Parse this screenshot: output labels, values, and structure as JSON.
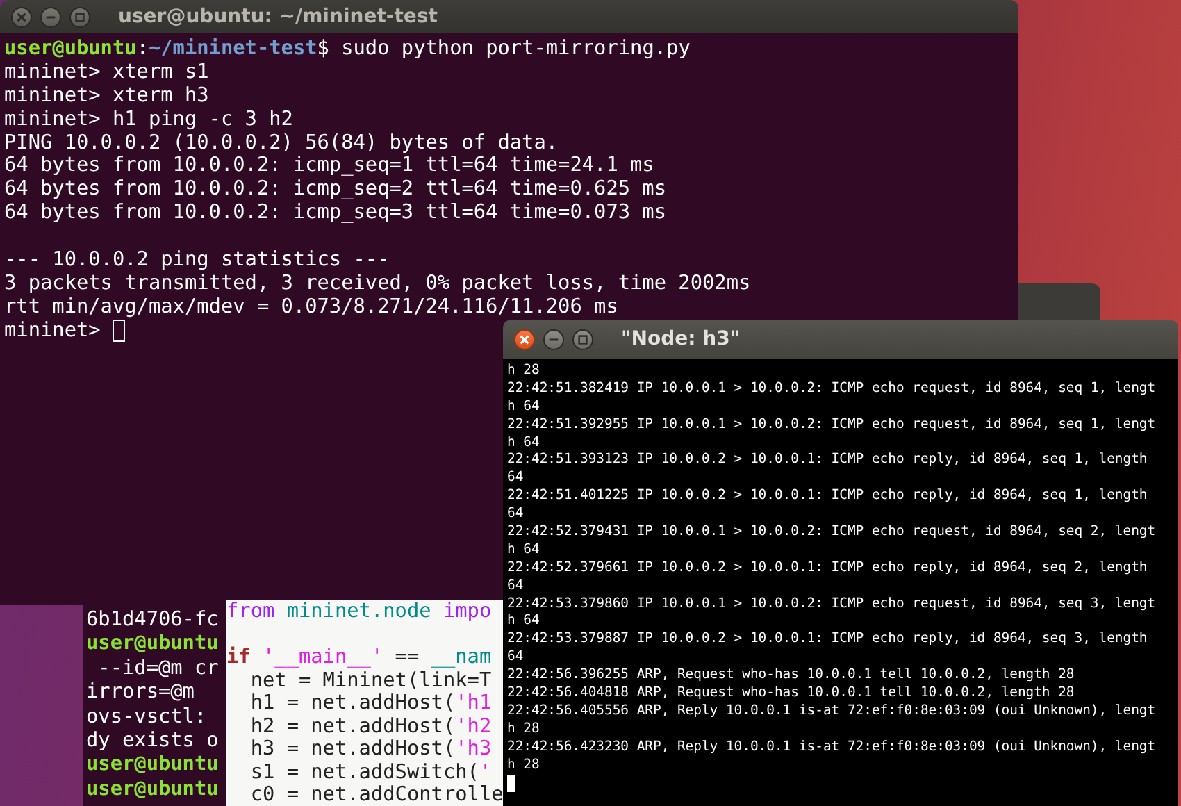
{
  "desktop": {
    "main_terminal": {
      "title": "user@ubuntu: ~/mininet-test",
      "focused": false,
      "lines": [
        {
          "spans": [
            {
              "kind": "user",
              "text": "user@ubuntu"
            },
            {
              "kind": "plain",
              "text": ":"
            },
            {
              "kind": "path",
              "text": "~/mininet-test"
            },
            {
              "kind": "plain",
              "text": "$ sudo python port-mirroring.py"
            }
          ]
        },
        {
          "text": "mininet> xterm s1"
        },
        {
          "text": "mininet> xterm h3"
        },
        {
          "text": "mininet> h1 ping -c 3 h2"
        },
        {
          "text": "PING 10.0.0.2 (10.0.0.2) 56(84) bytes of data."
        },
        {
          "text": "64 bytes from 10.0.0.2: icmp_seq=1 ttl=64 time=24.1 ms"
        },
        {
          "text": "64 bytes from 10.0.0.2: icmp_seq=2 ttl=64 time=0.625 ms"
        },
        {
          "text": "64 bytes from 10.0.0.2: icmp_seq=3 ttl=64 time=0.073 ms"
        },
        {
          "text": "--- 10.0.0.2 ping statistics ---",
          "space_before": true
        },
        {
          "text": "3 packets transmitted, 3 received, 0% packet loss, time 2002ms"
        },
        {
          "text": "rtt min/avg/max/mdev = 0.073/8.271/24.116/11.206 ms"
        },
        {
          "text": "mininet> ",
          "cursor": true
        }
      ]
    },
    "back_terminal": {
      "lines": [
        {
          "text": "6b1d4706-fc"
        },
        {
          "spans": [
            {
              "kind": "user",
              "text": "user@ubuntu"
            }
          ]
        },
        {
          "text": " --id=@m cr"
        },
        {
          "text": "irrors=@m"
        },
        {
          "text": "ovs-vsctl:"
        },
        {
          "text": "dy exists o"
        },
        {
          "spans": [
            {
              "kind": "user",
              "text": "user@ubuntu"
            }
          ]
        },
        {
          "spans": [
            {
              "kind": "user",
              "text": "user@ubuntu"
            }
          ]
        }
      ]
    },
    "editor": {
      "lines": [
        {
          "spans": [
            {
              "kind": "keyword",
              "text": "from"
            },
            {
              "kind": "name",
              "text": " mininet.node"
            },
            {
              "kind": "keyword",
              "text": " impo"
            }
          ]
        },
        {
          "spans": [
            {
              "kind": "conditional",
              "text": "if"
            },
            {
              "kind": "string",
              "text": " '__main__'"
            },
            {
              "kind": "plain",
              "text": " == "
            },
            {
              "kind": "name",
              "text": "__nam"
            }
          ],
          "space_before": true
        },
        {
          "text": "  net = Mininet(link=T"
        },
        {
          "spans": [
            {
              "kind": "plain",
              "text": "  h1 = net.addHost("
            },
            {
              "kind": "string",
              "text": "'h1"
            }
          ]
        },
        {
          "spans": [
            {
              "kind": "plain",
              "text": "  h2 = net.addHost("
            },
            {
              "kind": "string",
              "text": "'h2"
            }
          ]
        },
        {
          "spans": [
            {
              "kind": "plain",
              "text": "  h3 = net.addHost("
            },
            {
              "kind": "string",
              "text": "'h3"
            }
          ]
        },
        {
          "spans": [
            {
              "kind": "plain",
              "text": "  s1 = net.addSwitch("
            },
            {
              "kind": "string",
              "text": "'"
            }
          ]
        },
        {
          "text": "  c0 = net.addControlle"
        }
      ]
    },
    "node_window": {
      "title": "\"Node: h3\"",
      "focused": true,
      "cursor": true,
      "lines": [
        "h 28",
        "22:42:51.382419 IP 10.0.0.1 > 10.0.0.2: ICMP echo request, id 8964, seq 1, lengt",
        "h 64",
        "22:42:51.392955 IP 10.0.0.1 > 10.0.0.2: ICMP echo request, id 8964, seq 1, lengt",
        "h 64",
        "22:42:51.393123 IP 10.0.0.2 > 10.0.0.1: ICMP echo reply, id 8964, seq 1, length",
        "64",
        "22:42:51.401225 IP 10.0.0.2 > 10.0.0.1: ICMP echo reply, id 8964, seq 1, length",
        "64",
        "22:42:52.379431 IP 10.0.0.1 > 10.0.0.2: ICMP echo request, id 8964, seq 2, lengt",
        "h 64",
        "22:42:52.379661 IP 10.0.0.2 > 10.0.0.1: ICMP echo reply, id 8964, seq 2, length",
        "64",
        "22:42:53.379860 IP 10.0.0.1 > 10.0.0.2: ICMP echo request, id 8964, seq 3, lengt",
        "h 64",
        "22:42:53.379887 IP 10.0.0.2 > 10.0.0.1: ICMP echo reply, id 8964, seq 3, length",
        "64",
        "22:42:56.396255 ARP, Request who-has 10.0.0.1 tell 10.0.0.2, length 28",
        "22:42:56.404818 ARP, Request who-has 10.0.0.1 tell 10.0.0.2, length 28",
        "22:42:56.405556 ARP, Reply 10.0.0.1 is-at 72:ef:f0:8e:03:09 (oui Unknown), lengt",
        "h 28",
        "22:42:56.423230 ARP, Reply 10.0.0.1 is-at 72:ef:f0:8e:03:09 (oui Unknown), lengt",
        "h 28"
      ]
    }
  }
}
